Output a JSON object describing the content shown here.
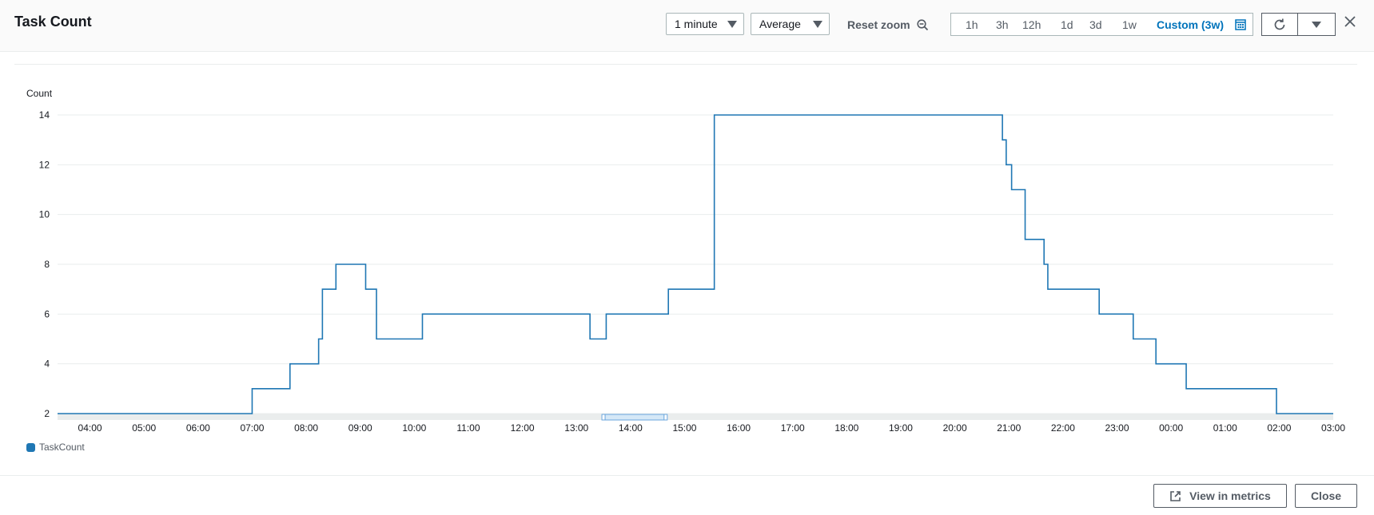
{
  "header": {
    "title": "Task Count",
    "period_select": "1 minute",
    "stat_select": "Average",
    "reset_zoom_label": "Reset zoom",
    "ranges": [
      "1h",
      "3h",
      "12h",
      "1d",
      "3d",
      "1w"
    ],
    "active_range": "Custom (3w)"
  },
  "icons": {
    "zoom_out": "zoom-out-icon",
    "calendar": "calendar-icon",
    "refresh": "refresh-icon",
    "dropdown": "caret-down-icon",
    "close": "close-icon",
    "external": "external-link-icon"
  },
  "footer": {
    "view_in_metrics": "View in metrics",
    "close": "Close"
  },
  "colors": {
    "series": "#1f77b4",
    "accent": "#0073bb"
  },
  "chart_data": {
    "type": "line",
    "ylabel": "Count",
    "ylim": [
      2,
      14
    ],
    "yticks": [
      2,
      4,
      6,
      8,
      10,
      12,
      14
    ],
    "xlabel": "",
    "xticks": [
      "04:00",
      "05:00",
      "06:00",
      "07:00",
      "08:00",
      "09:00",
      "10:00",
      "11:00",
      "12:00",
      "13:00",
      "14:00",
      "15:00",
      "16:00",
      "17:00",
      "18:00",
      "19:00",
      "20:00",
      "21:00",
      "22:00",
      "23:00",
      "00:00",
      "01:00",
      "02:00",
      "03:00"
    ],
    "legend": "bottom-left",
    "grid": true,
    "series": [
      {
        "name": "TaskCount",
        "step": true,
        "x_hours": [
          3.4,
          7.0,
          7.7,
          8.23,
          8.3,
          8.55,
          9.1,
          9.3,
          10.15,
          13.25,
          13.55,
          14.7,
          15.55,
          20.88,
          20.95,
          21.05,
          21.3,
          21.65,
          21.72,
          22.67,
          23.3,
          23.72,
          24.28,
          25.95,
          27.0
        ],
        "y": [
          2,
          3,
          4,
          5,
          7,
          8,
          7,
          5,
          6,
          5,
          6,
          7,
          14,
          13,
          12,
          11,
          9,
          8,
          7,
          6,
          5,
          4,
          3,
          2,
          2
        ]
      }
    ],
    "zoom_window": [
      13.5,
      14.65
    ]
  }
}
